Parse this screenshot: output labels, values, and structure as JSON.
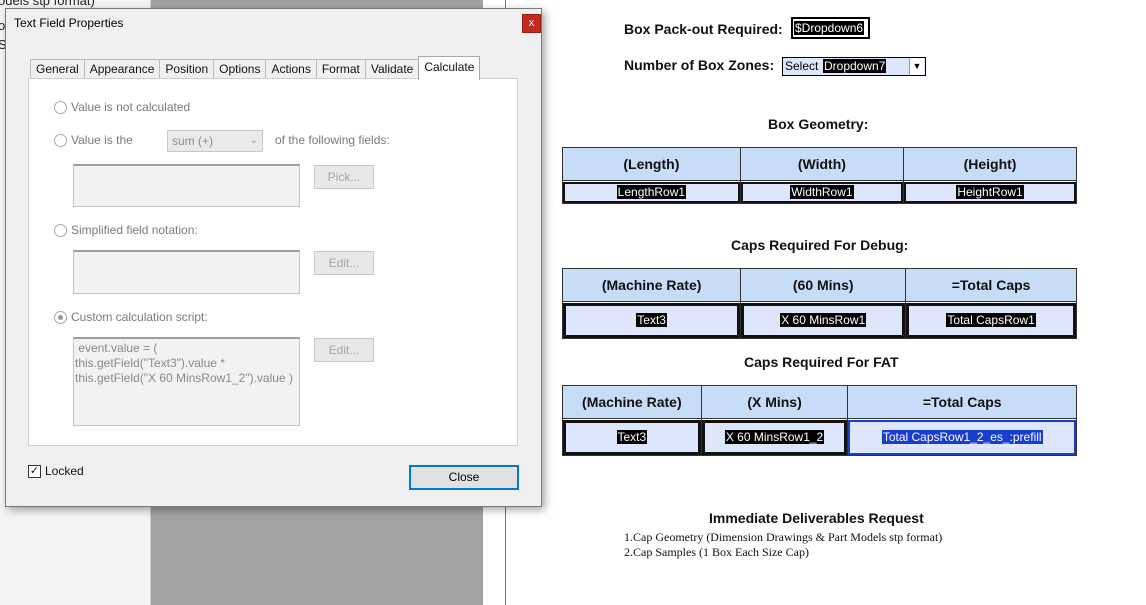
{
  "background": {
    "left_fragments": [
      "odels stp format)",
      "o",
      "S"
    ]
  },
  "form": {
    "pack_out_label": "Box Pack-out Required:",
    "pack_out_value": "$Dropdown6",
    "zones_label": "Number of Box Zones:",
    "zones_select_text": "Select",
    "zones_value": "Dropdown7",
    "geometry": {
      "title": "Box Geometry:",
      "headers": [
        "(Length)",
        "(Width)",
        "(Height)"
      ],
      "fields": [
        "LengthRow1",
        "WidthRow1",
        "HeightRow1"
      ]
    },
    "debug": {
      "title": "Caps Required For Debug:",
      "headers": [
        "(Machine Rate)",
        "(60 Mins)",
        "=Total Caps"
      ],
      "fields": [
        "Text3",
        "X 60 MinsRow1",
        "Total CapsRow1"
      ]
    },
    "fat": {
      "title": "Caps Required For FAT",
      "headers": [
        "(Machine Rate)",
        "(X Mins)",
        "=Total Caps"
      ],
      "fields": [
        "Text3",
        "X 60 MinsRow1_2",
        "Total CapsRow1_2_es_:prefill"
      ]
    },
    "deliverables": {
      "title": "Immediate Deliverables Request",
      "items": [
        "1.Cap Geometry (Dimension Drawings & Part Models stp format)",
        "2.Cap Samples (1 Box Each Size Cap)"
      ]
    }
  },
  "dialog": {
    "title": "Text Field Properties",
    "close_glyph": "x",
    "tabs": [
      "General",
      "Appearance",
      "Position",
      "Options",
      "Actions",
      "Format",
      "Validate",
      "Calculate"
    ],
    "active_tab": "Calculate",
    "option_not_calculated": "Value is not calculated",
    "option_value_is": "Value is the",
    "function_select": "sum (+)",
    "of_following": "of the following fields:",
    "pick_button": "Pick...",
    "option_simplified": "Simplified field notation:",
    "edit_button": "Edit...",
    "option_custom": "Custom calculation script:",
    "script_lines": [
      " event.value = (",
      "this.getField(\"Text3\").value *",
      "this.getField(\"X 60 MinsRow1_2\").value )"
    ],
    "locked_label": "Locked",
    "locked_checked": true,
    "close_button": "Close"
  }
}
